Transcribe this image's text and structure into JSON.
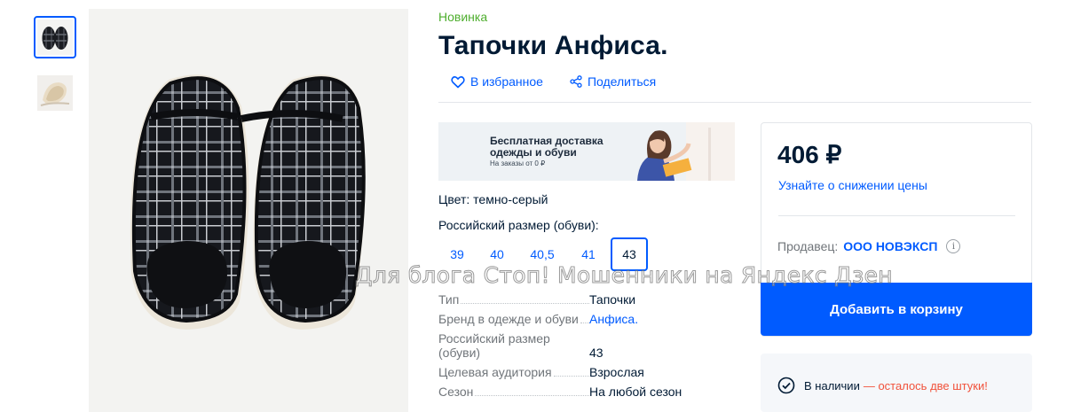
{
  "product": {
    "badge": "Новинка",
    "title": "Тапочки Анфиса."
  },
  "actions": {
    "favorite": "В избранное",
    "share": "Поделиться"
  },
  "promo": {
    "line1": "Бесплатная доставка",
    "line2": "одежды и обуви",
    "sub": "На заказы от 0 ₽"
  },
  "options": {
    "color_label": "Цвет: темно-серый",
    "size_label": "Российский размер (обуви):",
    "sizes": [
      "39",
      "40",
      "40,5",
      "41",
      "43"
    ],
    "selected_size": "43"
  },
  "specs": [
    {
      "key": "Тип",
      "value": "Тапочки"
    },
    {
      "key": "Бренд в одежде и обуви",
      "value": "Анфиса."
    },
    {
      "key": "Российский размер (обуви)",
      "value": "43"
    },
    {
      "key": "Целевая аудитория",
      "value": "Взрослая"
    },
    {
      "key": "Сезон",
      "value": "На любой сезон"
    }
  ],
  "buy": {
    "price": "406 ₽",
    "price_notify": "Узнайте о снижении цены",
    "seller_label": "Продавец:",
    "seller_name": "ООО НОВЭКСП",
    "info_glyph": "i",
    "add_to_cart": "Добавить в корзину",
    "stock": "В наличии",
    "stock_warning": "— осталось две штуки!"
  },
  "watermark": "Для блога Стоп! Мошенники на Яндекс Дзен",
  "colors": {
    "accent": "#005bff",
    "new_badge": "#4eae2e",
    "warning": "#f1523b",
    "text": "#001a34",
    "muted": "#70757a"
  }
}
